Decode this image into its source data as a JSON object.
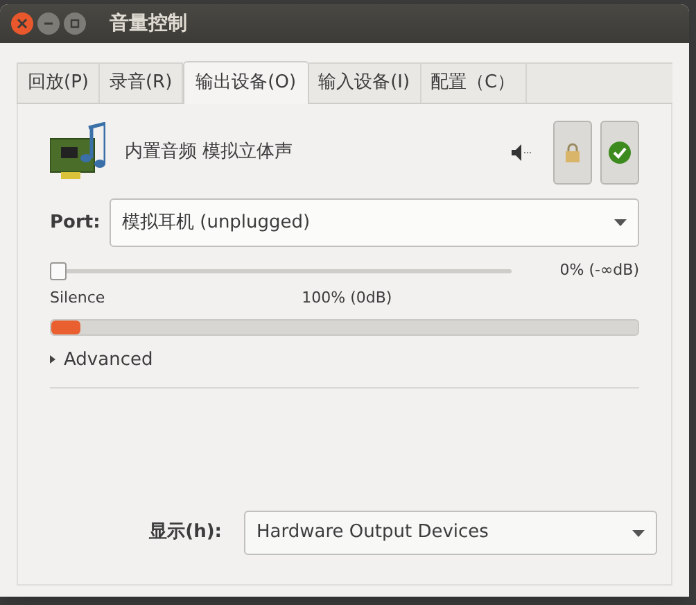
{
  "window": {
    "title": "音量控制"
  },
  "tabs": [
    {
      "label": "回放(P)",
      "selected": false
    },
    {
      "label": "录音(R)",
      "selected": false
    },
    {
      "label": "输出设备(O)",
      "selected": true
    },
    {
      "label": "输入设备(I)",
      "selected": false
    },
    {
      "label": "配置（C）",
      "selected": false
    }
  ],
  "device": {
    "name": "内置音频 模拟立体声",
    "port_label": "Port:",
    "port_value": "模拟耳机 (unplugged)",
    "volume": {
      "level": 0,
      "reading": "0% (-∞dB)",
      "silence_label": "Silence",
      "unity_label": "100% (0dB)"
    },
    "meter": {
      "level": 0.05
    },
    "advanced": {
      "label": "Advanced",
      "expanded": false
    }
  },
  "footer": {
    "label": "显示(h):",
    "value": "Hardware Output Devices"
  }
}
